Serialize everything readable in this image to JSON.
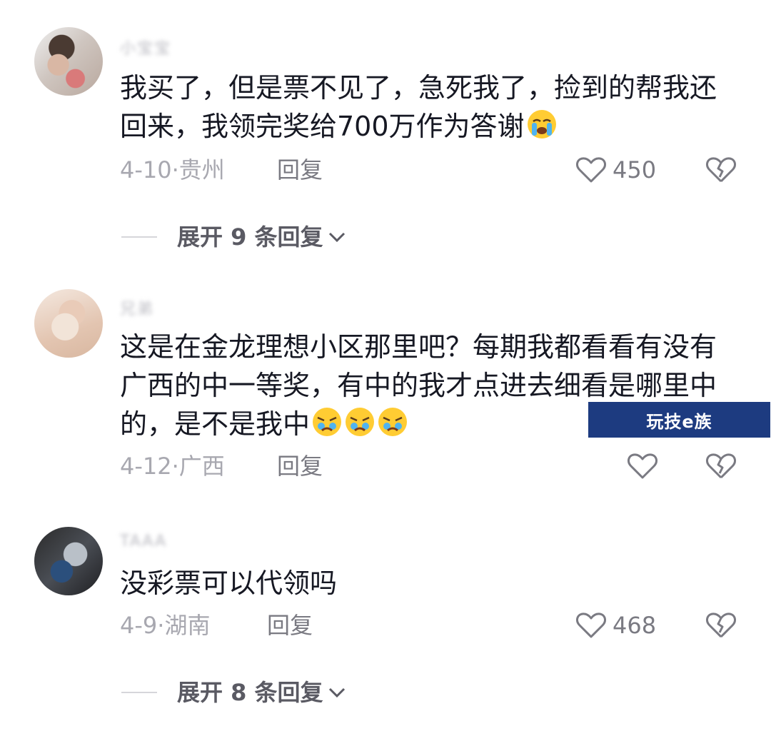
{
  "comments": [
    {
      "username": "小宝宝",
      "text": "我买了，但是票不见了，急死我了，捡到的帮我还回来，我领完奖给700万作为答谢",
      "emoji": "loudly-crying-face-emoji",
      "date": "4-10",
      "location": "贵州",
      "reply_label": "回复",
      "likes": "450",
      "expand_label": "展开 9 条回复"
    },
    {
      "username": "兄弟",
      "text": "这是在金龙理想小区那里吧？每期我都看看有没有广西的中一等奖，有中的我才点进去细看是哪里中的，是不是我中",
      "emoji": "crying-faces-emoji",
      "date": "4-12",
      "location": "广西",
      "reply_label": "回复",
      "likes": ""
    },
    {
      "username": "TAAA",
      "text": "没彩票可以代领吗",
      "date": "4-9",
      "location": "湖南",
      "reply_label": "回复",
      "likes": "468",
      "expand_label": "展开 8 条回复"
    }
  ],
  "watermark": "玩技e族",
  "colors": {
    "text": "#161823",
    "meta": "#a8a8b0",
    "watermark_bg": "#1d3b80"
  }
}
